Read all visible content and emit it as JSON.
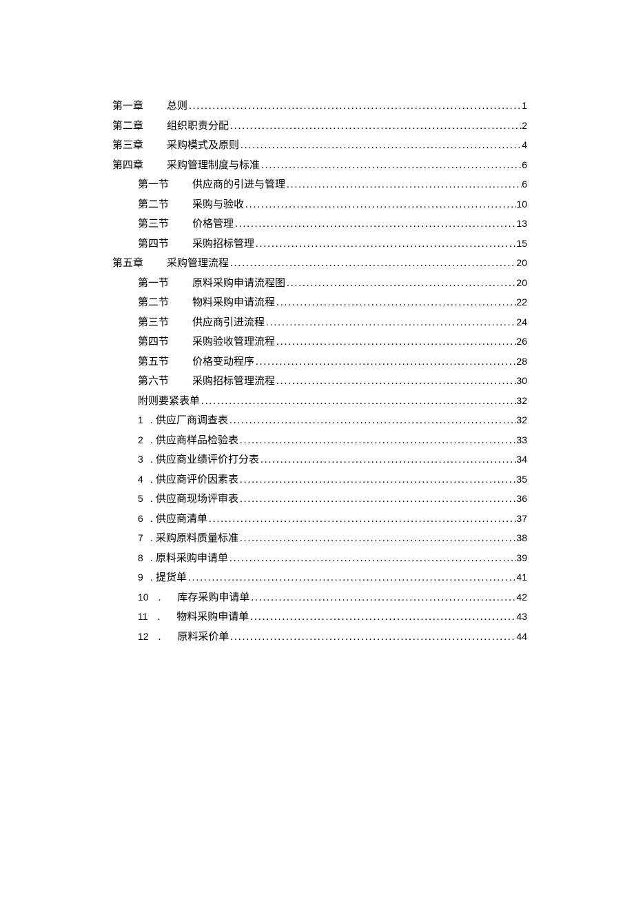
{
  "toc": [
    {
      "level": 0,
      "label": "第一章",
      "gap": 34,
      "title": "总则",
      "page": "1"
    },
    {
      "level": 0,
      "label": "第二章",
      "gap": 34,
      "title": "组织职责分配",
      "page": "2"
    },
    {
      "level": 0,
      "label": "第三章",
      "gap": 34,
      "title": "采购模式及原则",
      "page": "4"
    },
    {
      "level": 0,
      "label": "第四章",
      "gap": 34,
      "title": "采购管理制度与标准",
      "page": "6"
    },
    {
      "level": 1,
      "label": "第一节",
      "gap": 34,
      "title": "供应商的引进与管理",
      "page": "6"
    },
    {
      "level": 1,
      "label": "第二节",
      "gap": 34,
      "title": "采购与验收",
      "page": "10"
    },
    {
      "level": 1,
      "label": "第三节",
      "gap": 34,
      "title": "价格管理",
      "page": "13"
    },
    {
      "level": 1,
      "label": "第四节",
      "gap": 34,
      "title": "采购招标管理",
      "page": "15"
    },
    {
      "level": 0,
      "label": "第五章",
      "gap": 34,
      "title": "采购管理流程",
      "page": "20"
    },
    {
      "level": 1,
      "label": "第一节",
      "gap": 34,
      "title": "原料采购申请流程图",
      "page": "20"
    },
    {
      "level": 1,
      "label": "第二节",
      "gap": 34,
      "title": "物料采购申请流程",
      "page": "22"
    },
    {
      "level": 1,
      "label": "第三节",
      "gap": 34,
      "title": "供应商引进流程",
      "page": "24"
    },
    {
      "level": 1,
      "label": "第四节",
      "gap": 34,
      "title": "采购验收管理流程",
      "page": "26"
    },
    {
      "level": 1,
      "label": "第五节",
      "gap": 34,
      "title": "价格变动程序",
      "page": "28"
    },
    {
      "level": 1,
      "label": "第六节",
      "gap": 34,
      "title": "采购招标管理流程",
      "page": "30"
    },
    {
      "level": 1,
      "label": "",
      "gap": 0,
      "title": "附则要紧表单",
      "page": "32"
    },
    {
      "level": 1,
      "num": "1",
      "sep": ".",
      "title": "供应厂商调查表",
      "page": "32"
    },
    {
      "level": 1,
      "num": "2",
      "sep": ".",
      "title": "供应商样品检验表",
      "page": "33"
    },
    {
      "level": 1,
      "num": "3",
      "sep": ".",
      "title": "供应商业绩评价打分表",
      "page": "34"
    },
    {
      "level": 1,
      "num": "4",
      "sep": ".",
      "title": "供应商评价因素表",
      "page": "35"
    },
    {
      "level": 1,
      "num": "5",
      "sep": ".",
      "title": "供应商现场评审表",
      "page": "36"
    },
    {
      "level": 1,
      "num": "6",
      "sep": ".",
      "title": "供应商清单",
      "page": "37"
    },
    {
      "level": 1,
      "num": "7",
      "sep": ".",
      "title": "采购原料质量标准",
      "page": "38"
    },
    {
      "level": 1,
      "num": "8",
      "sep": ". ",
      "title": "原料采购申请单",
      "page": "39"
    },
    {
      "level": 1,
      "num": "9",
      "sep": ".",
      "title": "提货单",
      "page": "41"
    },
    {
      "level": 1,
      "num": "10",
      "sep2": ".",
      "title": "库存采购申请单",
      "page": "42"
    },
    {
      "level": 1,
      "num": "11",
      "sep2": ".",
      "title": "物料采购申请单",
      "page": "43"
    },
    {
      "level": 1,
      "num": "12",
      "sep2": ".",
      "title": "原料采价单",
      "page": "44"
    }
  ]
}
